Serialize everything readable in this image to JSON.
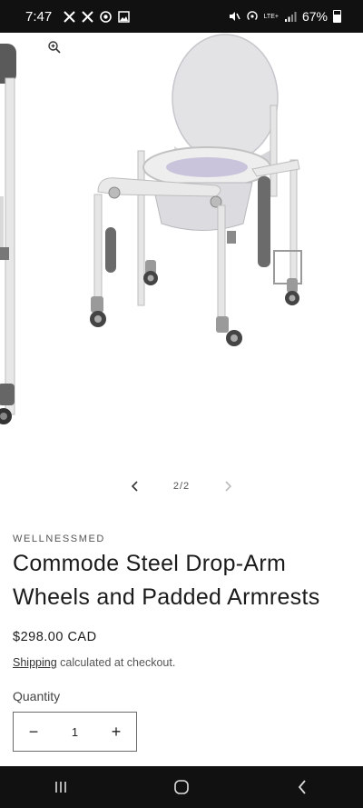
{
  "status_bar": {
    "time": "7:47",
    "notification_icons": [
      "x-icon",
      "x-icon",
      "chrome-icon",
      "gallery-icon"
    ],
    "signal_label": "LTE+",
    "battery": "67%"
  },
  "gallery": {
    "counter": "2/2",
    "image_subject": "commode-chair"
  },
  "product": {
    "vendor": "WELLNESSMED",
    "title": "Commode Steel Drop-Arm Wheels and Padded Armrests",
    "price": "$298.00 CAD",
    "shipping_link": "Shipping",
    "shipping_suffix": " calculated at checkout.",
    "quantity_label": "Quantity",
    "quantity_value": "1",
    "decrease_symbol": "−",
    "increase_symbol": "+"
  },
  "colors": {
    "status_bar_bg": "#111111",
    "nav_bar_bg": "#111111"
  }
}
